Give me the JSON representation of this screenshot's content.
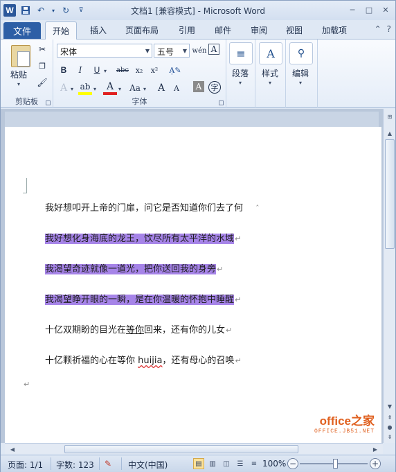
{
  "window": {
    "title": "文档1 [兼容模式] - Microsoft Word",
    "app_letter": "W"
  },
  "ribbon_tabs": {
    "file": "文件",
    "items": [
      "开始",
      "插入",
      "页面布局",
      "引用",
      "邮件",
      "审阅",
      "视图",
      "加载项"
    ],
    "active": "开始"
  },
  "clipboard": {
    "paste": "粘贴",
    "group_label": "剪贴板"
  },
  "font": {
    "name": "宋体",
    "size": "五号",
    "group_label": "字体",
    "buttons": {
      "bold": "B",
      "italic": "I",
      "underline": "U",
      "strike": "abc",
      "subscript": "x₂",
      "superscript": "x²",
      "grow": "A",
      "shrink": "A",
      "case": "Aa",
      "color": "A",
      "char_shading": "A",
      "enclose": "字"
    }
  },
  "paragraph": {
    "label": "段落"
  },
  "styles": {
    "label": "样式"
  },
  "editing": {
    "label": "编辑"
  },
  "document": {
    "lines": [
      {
        "text": "我好想叩开上帝的门扉，问它是否知道你们去了何",
        "mark": "",
        "highlight": false
      },
      {
        "text": "我好想化身海底的龙王，饮尽所有太平洋的水域",
        "mark": "↵",
        "highlight": true
      },
      {
        "text": "我渴望奇迹就像一道光，把你送回我的身旁",
        "mark": "↵",
        "highlight": true
      },
      {
        "text": "我渴望睁开眼的一瞬，是在你温暖的怀抱中睡醒",
        "mark": "↵",
        "highlight": true
      },
      {
        "text_a": "十亿双期盼的目光在",
        "text_b": "等你",
        "text_c": "回来，还有你的儿女",
        "mark": "↵"
      },
      {
        "text_a": "十亿颗祈福的心在等你 ",
        "text_b": "huijia",
        "text_c": "，还有母心的召唤",
        "mark": "↵"
      }
    ],
    "last_mark": "↵",
    "highlight_color": "#a684e8"
  },
  "watermark": {
    "main": "office之家",
    "sub": "OFFICE.JB51.NET"
  },
  "statusbar": {
    "page": "页面: 1/1",
    "words": "字数: 123",
    "language": "中文(中国)",
    "zoom": "100%",
    "zoom_value": 1.0
  }
}
